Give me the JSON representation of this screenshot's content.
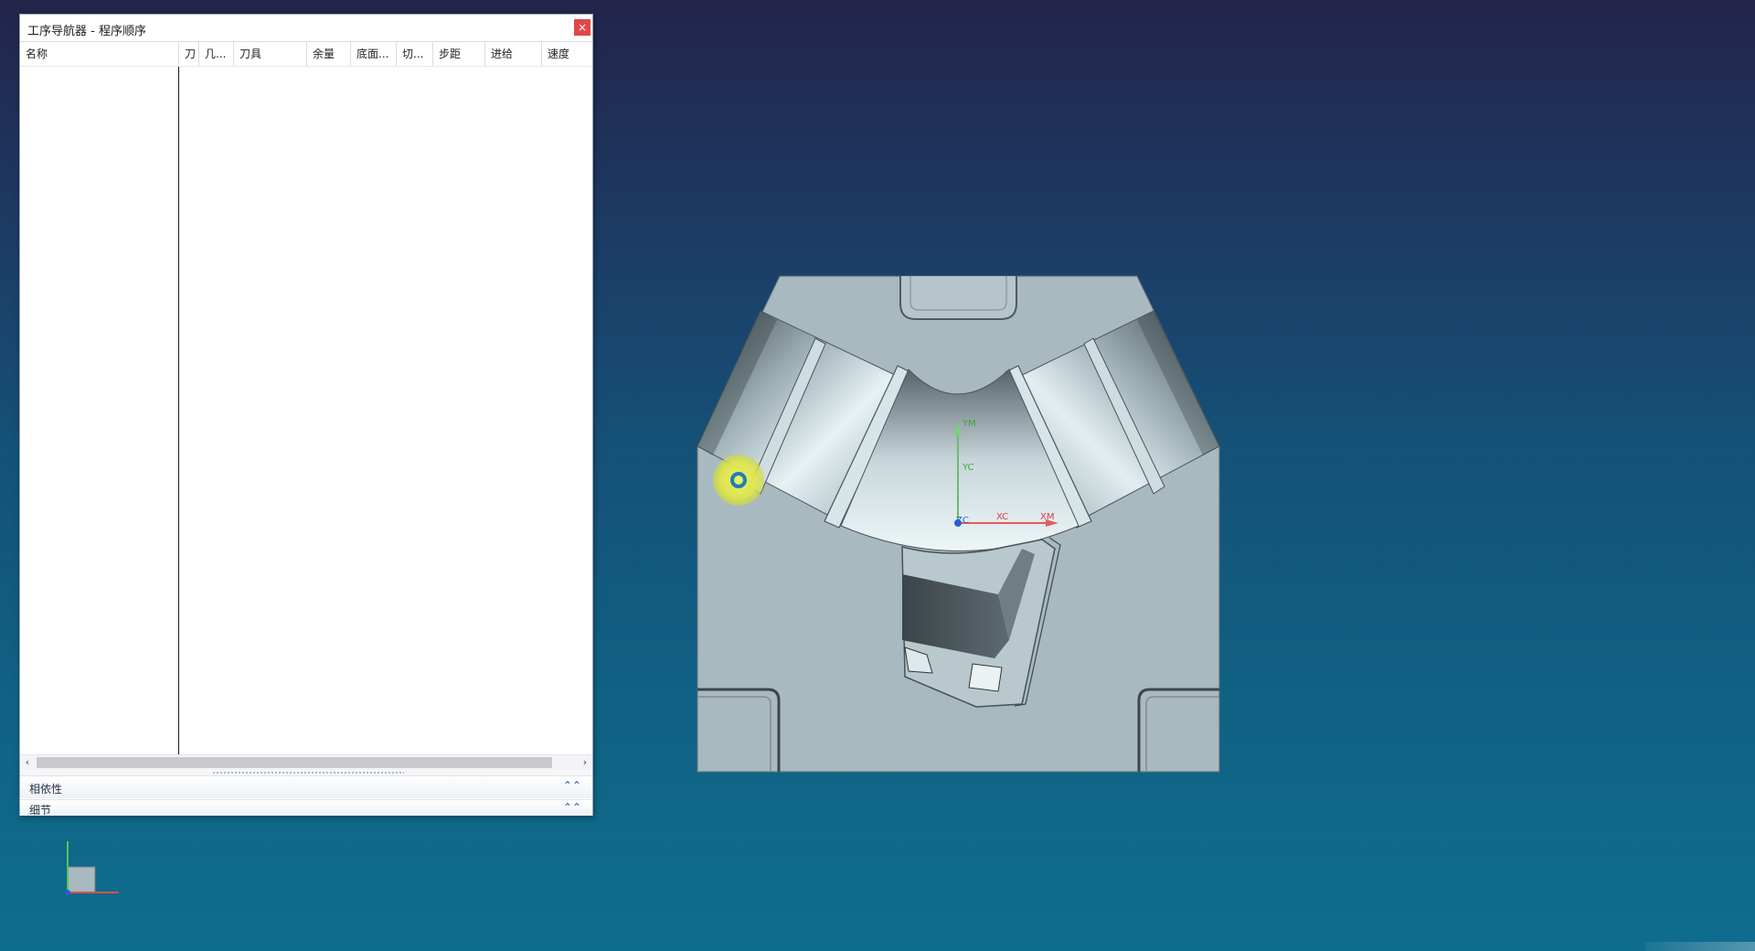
{
  "window": {
    "title": "工序导航器 - 程序顺序",
    "close_label": "×"
  },
  "columns": [
    "名称",
    "刀",
    "几...",
    "刀具",
    "余量",
    "底面...",
    "切...",
    "步距",
    "进给",
    "速度"
  ],
  "scrollbar": {
    "left_arrow": "‹",
    "right_arrow": "›"
  },
  "panels": [
    {
      "label": "相依性",
      "chevron": "⌃⌃"
    },
    {
      "label": "细节",
      "chevron": "⌃⌃"
    }
  ],
  "wcs_labels": {
    "yc": "YC",
    "ym": "YM",
    "xc": "XC",
    "xm": "XM",
    "zc": "ZC"
  },
  "colors": {
    "accent_close": "#e04848",
    "panel_chevron": "#2a56b8",
    "part": "#a8b9c0"
  }
}
